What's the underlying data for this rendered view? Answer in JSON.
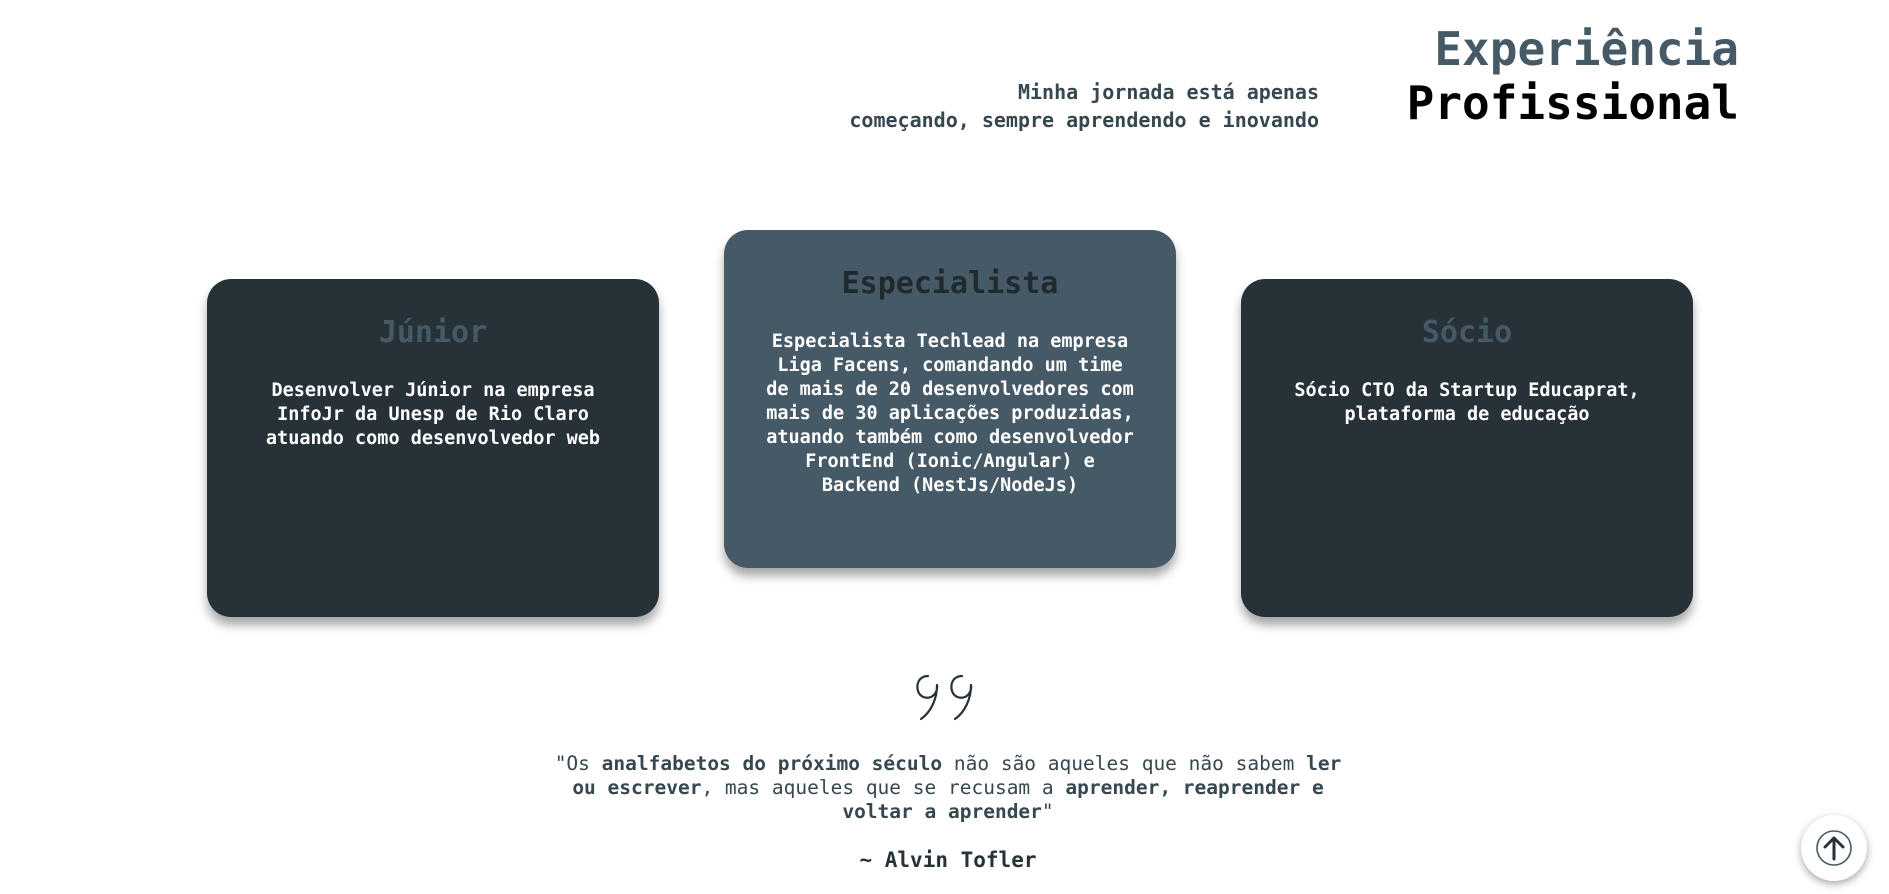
{
  "header": {
    "title_line1": "Experiência",
    "title_line2": "Profissional",
    "tagline_line1": "Minha jornada está apenas",
    "tagline_line2": "começando, sempre aprendendo e inovando"
  },
  "cards": [
    {
      "title": "Júnior",
      "description": "Desenvolver Júnior na empresa InfoJr da Unesp de Rio Claro atuando como desenvolvedor web"
    },
    {
      "title": "Especialista",
      "description": "Especialista Techlead na empresa Liga Facens, comandando um time de mais de 20 desenvolvedores com mais de 30 aplicações produzidas, atuando também como desenvolvedor FrontEnd (Ionic/Angular) e Backend (NestJs/NodeJs)"
    },
    {
      "title": "Sócio",
      "description": "Sócio CTO da Startup Educaprat, plataforma de educação"
    }
  ],
  "quote": {
    "icon": "quote-icon",
    "seg1": "\"Os ",
    "seg2": "analfabetos do próximo século",
    "seg3": " não são aqueles que não sabem ",
    "seg4": "ler ou escrever",
    "seg5": ", mas aqueles que se recusam a ",
    "seg6": "aprender, reaprender e voltar a aprender",
    "seg7": "\"",
    "author": "~ Alvin Tofler"
  },
  "scroll_top": {
    "icon": "arrow-up-icon"
  },
  "colors": {
    "primary": "#455a66",
    "dark_card": "#263238",
    "text_dark": "#37474f"
  }
}
